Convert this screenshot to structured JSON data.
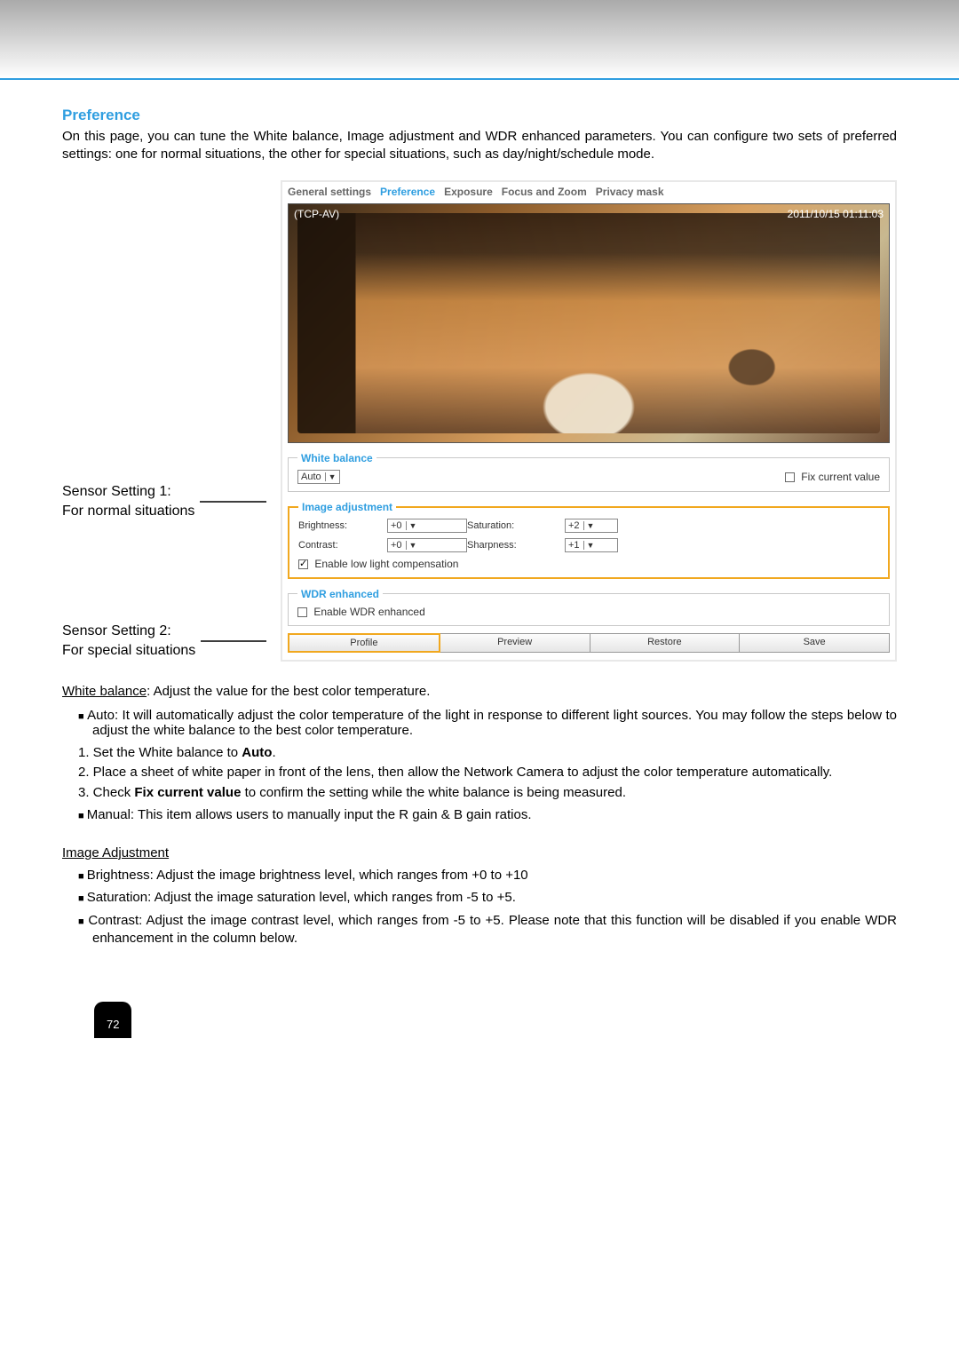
{
  "section_title": "Preference",
  "intro": "On this page, you can tune the White balance, Image adjustment and WDR enhanced parameters. You can configure two sets of preferred settings: one for normal situations, the other for special situations, such as day/night/schedule mode.",
  "side": {
    "s1a": "Sensor Setting 1:",
    "s1b": "For normal situations",
    "s2a": "Sensor Setting 2:",
    "s2b": "For special situations"
  },
  "tabs": [
    "General settings",
    "Preference",
    "Exposure",
    "Focus and Zoom",
    "Privacy mask"
  ],
  "video": {
    "device": "(TCP-AV)",
    "timestamp": "2011/10/15 01:11:03"
  },
  "wb": {
    "legend": "White balance",
    "mode": "Auto",
    "fix_label": "Fix current value"
  },
  "ia": {
    "legend": "Image adjustment",
    "brightness_label": "Brightness:",
    "brightness_val": "+0",
    "contrast_label": "Contrast:",
    "contrast_val": "+0",
    "saturation_label": "Saturation:",
    "saturation_val": "+2",
    "sharpness_label": "Sharpness:",
    "sharpness_val": "+1",
    "lowlight_label": "Enable low light compensation"
  },
  "wdr": {
    "legend": "WDR enhanced",
    "label": "Enable WDR enhanced"
  },
  "buttons": {
    "profile": "Profile",
    "preview": "Preview",
    "restore": "Restore",
    "save": "Save"
  },
  "wb_desc_lead": "White balance",
  "wb_desc_rest": ": Adjust the value for the best color temperature.",
  "wb_auto_bullet": "Auto: It will automatically adjust the color temperature of the light in response to different light sources. You may follow the steps below to adjust the white balance to the best color temperature.",
  "steps": {
    "s1a": "1. Set the White balance to ",
    "s1b": "Auto",
    "s1c": ".",
    "s2": "2. Place a sheet of white paper in front of the lens, then allow the Network Camera to adjust the color temperature automatically.",
    "s3a": "3. Check ",
    "s3b": "Fix current value",
    "s3c": " to confirm the setting while the white balance is being measured."
  },
  "wb_manual_bullet": "Manual: This item allows users to manually input the R gain & B gain ratios.",
  "ia_heading": "Image Adjustment",
  "ia_bullets": {
    "b1": "Brightness: Adjust the image brightness level, which ranges from +0 to +10",
    "b2": "Saturation: Adjust the image saturation level, which ranges from -5 to +5.",
    "b3": "Contrast: Adjust the image contrast level, which ranges from -5 to +5. Please note that this function will be disabled if you enable WDR enhancement in the column below."
  },
  "page_num": "72"
}
